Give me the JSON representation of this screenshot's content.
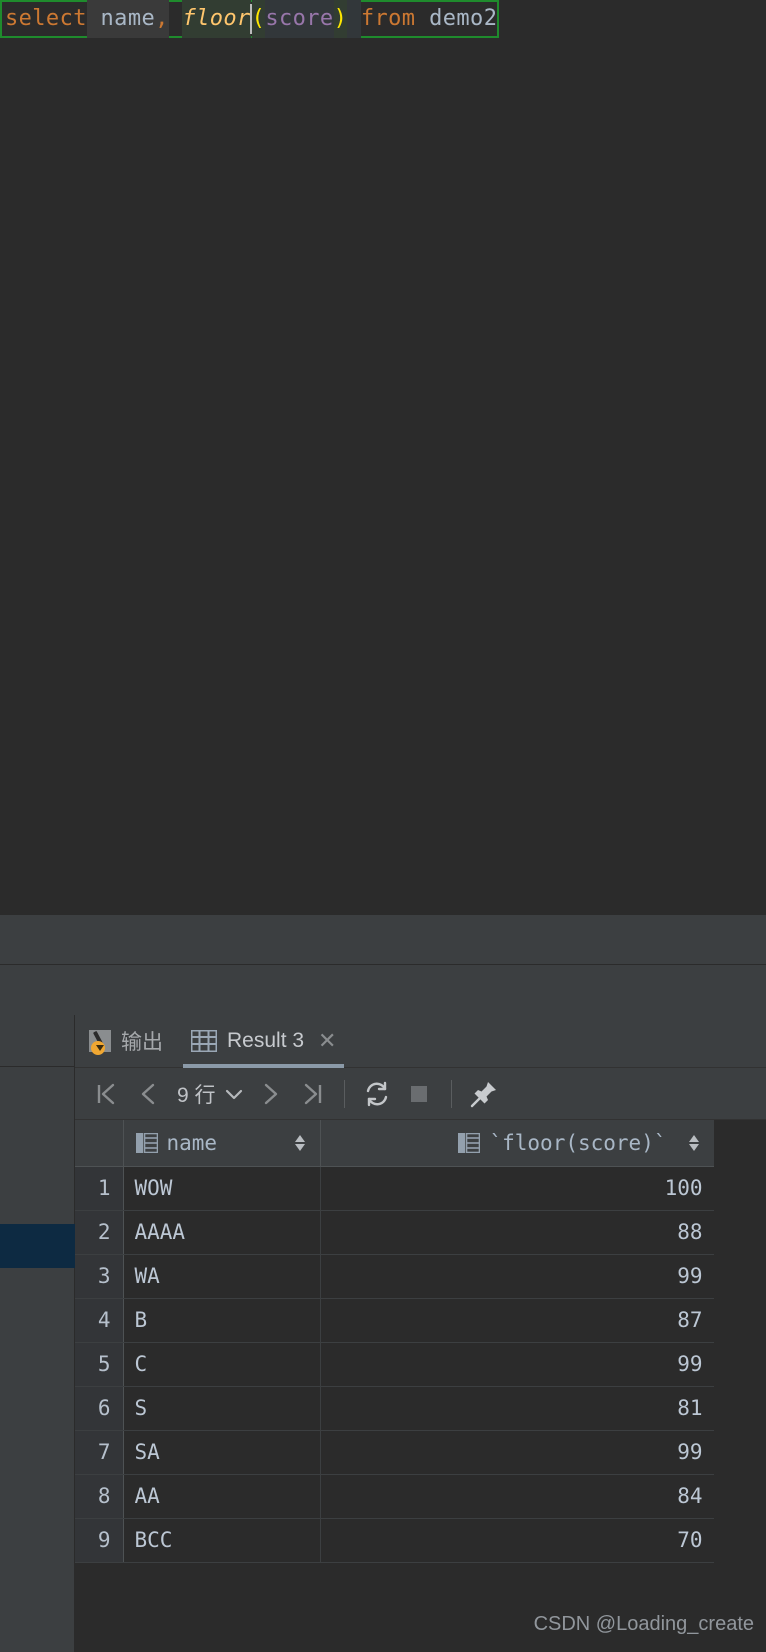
{
  "editor": {
    "query_text": "select name, floor(score) from demo2",
    "tokens": [
      {
        "text": "select",
        "kind": "keyword"
      },
      {
        "text": " ",
        "kind": "space"
      },
      {
        "text": "name",
        "kind": "identifier"
      },
      {
        "text": ",",
        "kind": "punct"
      },
      {
        "text": " ",
        "kind": "space"
      },
      {
        "text": "floor",
        "kind": "function"
      },
      {
        "text": "(",
        "kind": "paren"
      },
      {
        "text": "score",
        "kind": "param"
      },
      {
        "text": ")",
        "kind": "paren"
      },
      {
        "text": " ",
        "kind": "space"
      },
      {
        "text": "from",
        "kind": "keyword"
      },
      {
        "text": " ",
        "kind": "space"
      },
      {
        "text": "demo2",
        "kind": "identifier"
      }
    ],
    "colors": {
      "keyword": "#cc7832",
      "identifier": "#a9b7c6",
      "function": "#ffc66d",
      "paren": "#ffe700",
      "param": "#9876aa",
      "background": "#2b2b2b",
      "selection_border": "#1f8b2d",
      "caret": "#bbbbbb"
    }
  },
  "tabs": [
    {
      "label": "输出",
      "icon": "output-icon",
      "active": false,
      "closable": false
    },
    {
      "label": "Result 3",
      "icon": "grid-icon",
      "active": true,
      "closable": true,
      "close_label": "✕"
    }
  ],
  "toolbar": {
    "first_page_icon": "first-page-icon",
    "prev_page_icon": "previous-page-icon",
    "rows_label": "9 行",
    "rows_dropdown_icon": "chevron-down-icon",
    "next_page_icon": "next-page-icon",
    "last_page_icon": "last-page-icon",
    "refresh_icon": "refresh-icon",
    "stop_icon": "stop-icon",
    "pin_icon": "pin-icon"
  },
  "result_grid": {
    "columns": [
      {
        "label": "",
        "icon": "",
        "sortable": false
      },
      {
        "label": "name",
        "icon": "column-icon",
        "sortable": true
      },
      {
        "label": "`floor(score)`",
        "icon": "column-icon",
        "sortable": true
      }
    ],
    "rows": [
      {
        "num": "1",
        "name": "WOW",
        "value": "100"
      },
      {
        "num": "2",
        "name": "AAAA",
        "value": "88"
      },
      {
        "num": "3",
        "name": "WA",
        "value": "99"
      },
      {
        "num": "4",
        "name": "B",
        "value": "87"
      },
      {
        "num": "5",
        "name": "C",
        "value": "99"
      },
      {
        "num": "6",
        "name": "S",
        "value": "81"
      },
      {
        "num": "7",
        "name": "SA",
        "value": "99"
      },
      {
        "num": "8",
        "name": "AA",
        "value": "84"
      },
      {
        "num": "9",
        "name": "BCC",
        "value": "70"
      }
    ]
  },
  "watermark": {
    "text": "CSDN @Loading_create"
  }
}
